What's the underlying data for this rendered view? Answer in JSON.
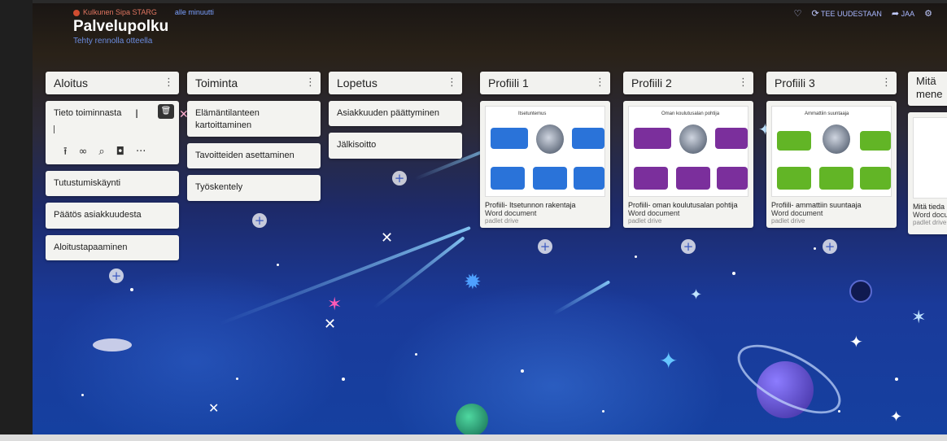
{
  "header": {
    "crumb_user": "Kulkunen Sipa STARG",
    "crumb_time": "alle minuutti",
    "title": "Palvelupolku",
    "subtitle": "Tehty rennolla otteella"
  },
  "topbar": {
    "remake": "TEE UUDESTAAN",
    "share": "JAA"
  },
  "columns": [
    {
      "title": "Aloitus",
      "editing_card": {
        "title": "Tieto toiminnasta"
      },
      "cards": [
        "Tutustumiskäynti",
        "Päätös asiakkuudesta",
        "Aloitustapaaminen"
      ]
    },
    {
      "title": "Toiminta",
      "cards": [
        "Elämäntilanteen kartoittaminen",
        "Tavoitteiden asettaminen",
        "Työskentely"
      ]
    },
    {
      "title": "Lopetus",
      "cards": [
        "Asiakkuuden päättyminen",
        "Jälkisoitto"
      ]
    },
    {
      "title": "Profiili 1",
      "doc": {
        "title": "Profiili- Itsetunnon rakentaja",
        "type": "Word document",
        "source": "padlet drive",
        "thumb_title": "Itsetuntemus"
      },
      "accent": "#2a73d9"
    },
    {
      "title": "Profiili 2",
      "doc": {
        "title": "Profiili- oman koulutusalan pohtija",
        "type": "Word document",
        "source": "padlet drive",
        "thumb_title": "Oman koulutusalan pohtija"
      },
      "accent": "#7b2f9c"
    },
    {
      "title": "Profiili 3",
      "doc": {
        "title": "Profiili- ammattiin suuntaaja",
        "type": "Word document",
        "source": "padlet drive",
        "thumb_title": "Ammattiin suuntaaja"
      },
      "accent": "#62b526"
    },
    {
      "title": "Mitä mene",
      "doc": {
        "title": "Mitä tieda",
        "type": "Word docu",
        "source": "padlet drive"
      }
    }
  ],
  "icons": {
    "upload": "upload-icon",
    "link": "link-icon",
    "search": "search-icon",
    "camera": "camera-icon",
    "more": "more-icon",
    "trash": "trash-icon",
    "kebab": "kebab-icon",
    "add": "add-icon",
    "heart": "heart-icon",
    "remake": "remake-icon",
    "share": "share-icon",
    "settings": "gear-icon"
  }
}
